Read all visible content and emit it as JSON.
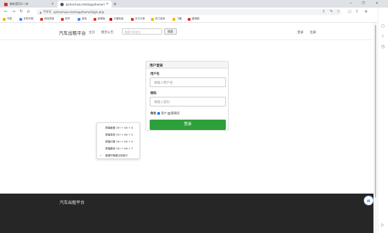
{
  "browser": {
    "tabs": [
      {
        "label": "新标签页1一浏",
        "favicon_color": "#d93025",
        "active": false
      },
      {
        "label": "qichechuzu.test/app/home/login.php",
        "favicon_color": "#555555",
        "active": true
      }
    ],
    "new_tab": "+",
    "window_controls": [
      "─",
      "❐",
      "✕"
    ],
    "address": {
      "lock": "▲",
      "insecure": "不安全",
      "url": "qichechuzu.test/app/home/login.php"
    },
    "bookmarks": [
      {
        "label": "书签",
        "color": "#f4b400"
      },
      {
        "label": "手机书签",
        "color": "#4285f4"
      },
      {
        "label": "网址导航",
        "color": "#d93025"
      },
      {
        "label": "知乎",
        "color": "#d93025"
      },
      {
        "label": "游戏",
        "color": "#4285f4"
      },
      {
        "label": "新闻版",
        "color": "#d93025"
      },
      {
        "label": "中国电信",
        "color": "#c00000"
      },
      {
        "label": "东方头条",
        "color": "#d93025"
      },
      {
        "label": "热门游戏",
        "color": "#f4b400"
      },
      {
        "label": "飞猪",
        "color": "#f4b400"
      },
      {
        "label": "爱短剧",
        "color": "#d93025"
      }
    ]
  },
  "site": {
    "brand": "汽车出租平台",
    "nav": [
      "主页",
      "租赁公告"
    ],
    "search_placeholder": "搜索汽车型号",
    "search_button": "搜索",
    "auth": [
      "登录",
      "注册"
    ]
  },
  "login": {
    "title": "用户登录",
    "username_label": "用户名",
    "username_placeholder": "请输入用户名",
    "password_label": "密码",
    "password_placeholder": "请输入密码",
    "role_label": "角色",
    "role_options": [
      "用户",
      "管理员"
    ],
    "selected_role": "用户",
    "submit": "登录"
  },
  "context_menu": {
    "items": [
      "屏幕截图 Ctrl + Alt + A",
      "屏幕录制 Ctrl + Alt + S",
      "屏幕识图 Ctrl + Alt + O",
      "屏幕翻译 Ctrl + Alt + T",
      "截图时隐藏当前窗口"
    ],
    "checked_index": 4,
    "check_mark": "✓"
  },
  "footer": {
    "brand": "汽车出租平台"
  },
  "floating_button": {
    "label": "AI"
  }
}
